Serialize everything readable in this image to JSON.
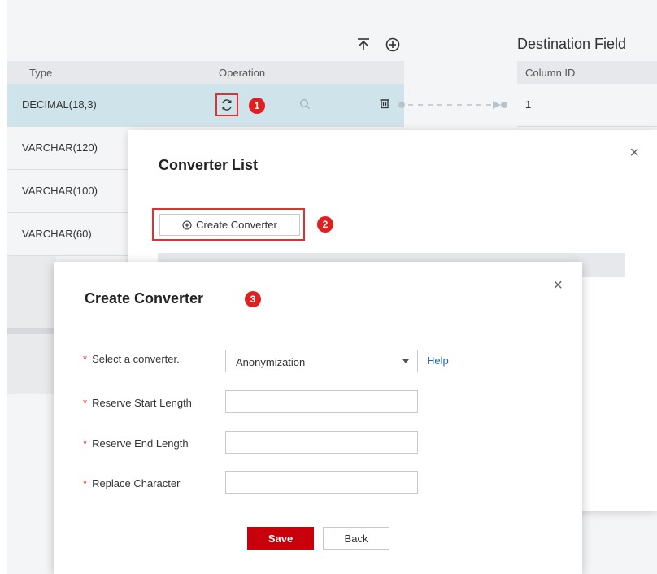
{
  "toolbar": {
    "upload_icon": "upload-icon",
    "add_icon": "add-circle-icon",
    "destination_title": "Destination Field"
  },
  "source_table": {
    "headers": {
      "type": "Type",
      "operation": "Operation"
    },
    "rows": [
      {
        "type": "DECIMAL(18,3)"
      },
      {
        "type": "VARCHAR(120)"
      },
      {
        "type": "VARCHAR(100)"
      },
      {
        "type": "VARCHAR(60)"
      }
    ]
  },
  "dest_table": {
    "headers": {
      "column_id": "Column ID"
    },
    "rows": [
      {
        "column_id": "1"
      }
    ]
  },
  "badges": {
    "b1": "1",
    "b2": "2",
    "b3": "3"
  },
  "converter_list": {
    "title": "Converter List",
    "create_button": "Create Converter",
    "close": "×"
  },
  "create_converter": {
    "title": "Create Converter",
    "close": "×",
    "fields": {
      "select_converter": {
        "label": "Select a converter.",
        "value": "Anonymization",
        "help": "Help"
      },
      "reserve_start": {
        "label": "Reserve Start Length",
        "value": ""
      },
      "reserve_end": {
        "label": "Reserve End Length",
        "value": ""
      },
      "replace_char": {
        "label": "Replace Character",
        "value": ""
      }
    },
    "required_mark": "*",
    "save": "Save",
    "back": "Back"
  },
  "colors": {
    "accent_red": "#c7000b",
    "highlight_red": "#e03030",
    "selected_row": "#cfe3ea",
    "link": "#1f5fd1"
  }
}
